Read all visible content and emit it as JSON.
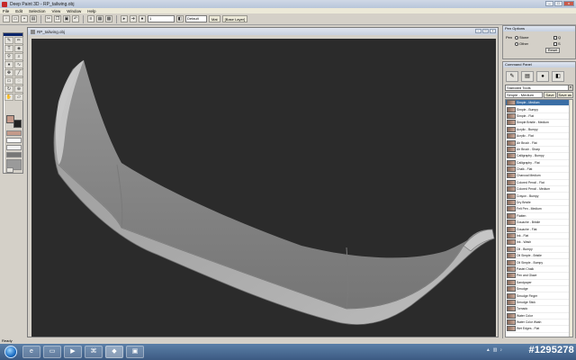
{
  "window": {
    "title": "Deep Paint 3D - RP_tailwing.obj"
  },
  "menu": [
    "File",
    "Edit",
    "Selection",
    "View",
    "Window",
    "Help"
  ],
  "toolbar": {
    "zoom_value": "1",
    "channel_value": "Default",
    "layer_button": "Mat",
    "layer_label": "[Base Layer]"
  },
  "document": {
    "title": "RP_tailwing.obj"
  },
  "pen_options": {
    "title": "Pen Options",
    "pen_label": "Pen",
    "opt1": "Stone",
    "opt2": "Other",
    "check1": "Q",
    "check2": "S",
    "reset": "Reset"
  },
  "command_panel": {
    "title": "Command Panel",
    "tool_select": "Standard Tools",
    "preset": "Simple - Medium",
    "btn_save": "Save",
    "btn_save_as": "Save as",
    "brushes": [
      "Simple - Medium",
      "Simple - Bumpy",
      "Simple - Flat",
      "Simple Bristle - Medium",
      "Acrylic - Bumpy",
      "Acrylic - Flat",
      "Air Brush - Flat",
      "Air Brush - Sharp",
      "Calligraphy - Bumpy",
      "Calligraphy - Flat",
      "Chalk - Flat",
      "Charcoal Medium",
      "Colored Pencil - Flat",
      "Colored Pencil - Medium",
      "Crayon - Bumpy",
      "Dry Bristle",
      "Felt Pen - Medium",
      "Flatten",
      "Gouache - Bristle",
      "Gouache - Flat",
      "Ink - Flat",
      "Ink - Wash",
      "Oil - Bumpy",
      "Oil Simple - Bristle",
      "Oil Simple - Bumpy",
      "Pastel Chalk",
      "Pen and Glaze",
      "Sandpaper",
      "Smudge",
      "Smudge Finger",
      "Smudge Stick",
      "Tornado",
      "Water Color",
      "Water Color Wash",
      "Wet Edges - Flat"
    ]
  },
  "status": {
    "text": "Ready"
  },
  "watermark": "#1295278",
  "colors": {
    "primary": "#c49a8a",
    "secondary": "#222222",
    "viewport": "#2b2b2b"
  }
}
